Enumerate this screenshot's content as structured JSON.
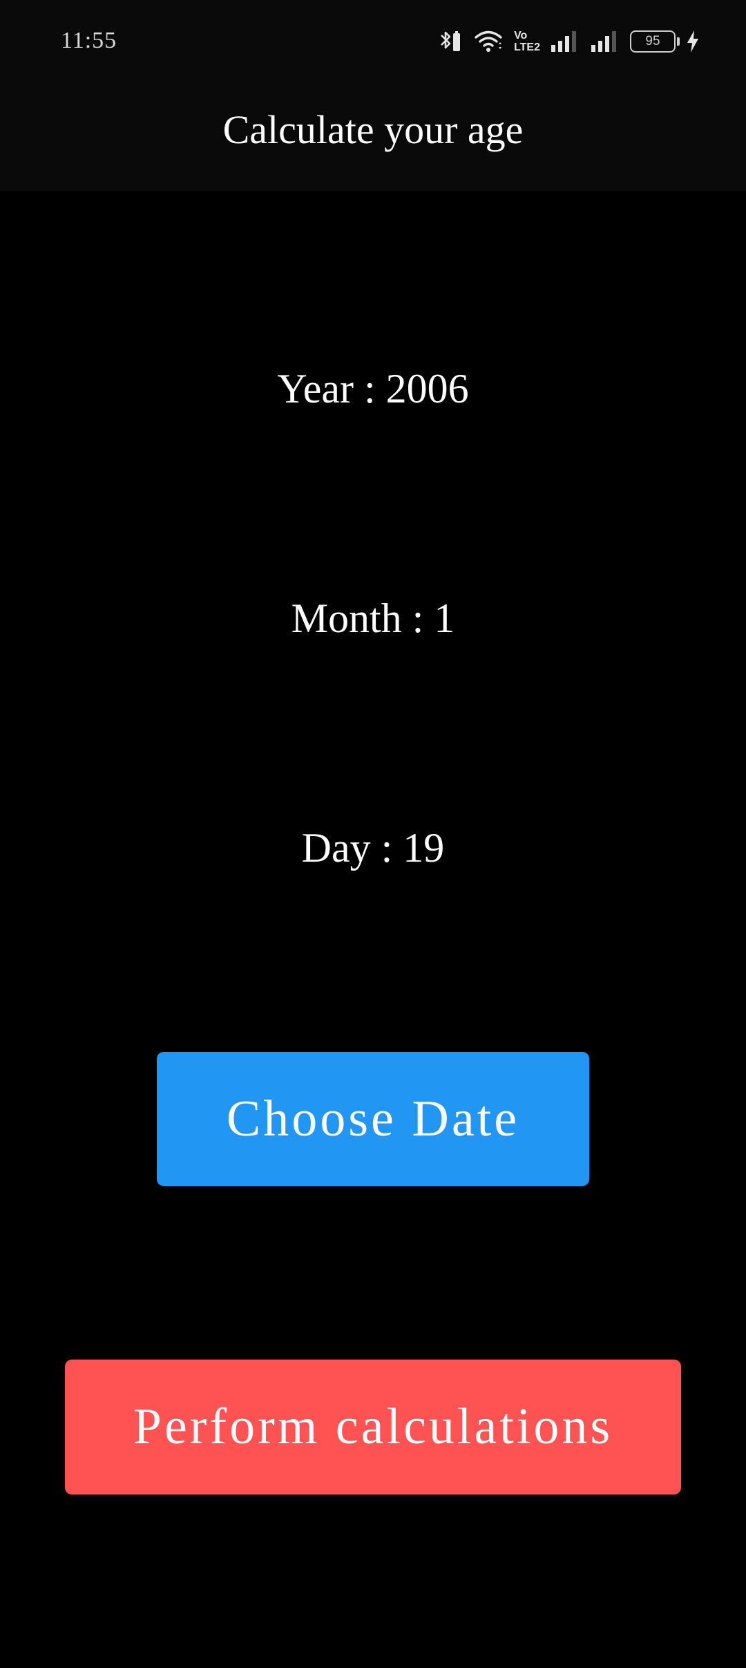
{
  "status_bar": {
    "time": "11:55",
    "volte_top": "Vo",
    "volte_bottom": "LTE2",
    "battery_level": "95",
    "icons": [
      "bluetooth-icon",
      "wifi-icon",
      "volte-icon",
      "signal-icon",
      "signal-icon",
      "battery-icon",
      "charging-icon"
    ]
  },
  "app_bar": {
    "title": "Calculate your age"
  },
  "values": {
    "year": "Year : 2006",
    "month": "Month : 1",
    "day": "Day : 19"
  },
  "buttons": {
    "choose_date": "Choose Date",
    "perform": "Perform calculations"
  },
  "colors": {
    "background": "#000000",
    "app_bar": "#0a0a0a",
    "choose_button": "#2196f3",
    "perform_button": "#ff5252",
    "text": "#ffffff"
  }
}
